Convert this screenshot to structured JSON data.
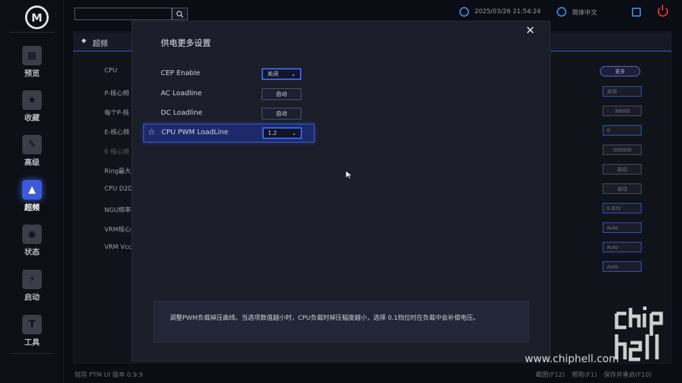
{
  "sidebar": {
    "logo_letter": "M",
    "items": [
      {
        "label": "预览",
        "icon": "grid-icon",
        "active": false
      },
      {
        "label": "收藏",
        "icon": "star-icon",
        "active": false
      },
      {
        "label": "高级",
        "icon": "tools-icon",
        "active": false
      },
      {
        "label": "超频",
        "icon": "rocket-icon",
        "active": true
      },
      {
        "label": "状态",
        "icon": "eye-icon",
        "active": false
      },
      {
        "label": "启动",
        "icon": "boot-icon",
        "active": false
      },
      {
        "label": "工具",
        "icon": "hammer-icon",
        "active": false
      }
    ]
  },
  "topbar": {
    "search_placeholder": "",
    "datetime": "2025/03/26 21:54:24",
    "language": "简体中文"
  },
  "background": {
    "section_title": "超频",
    "more_button": "更多",
    "rows": [
      {
        "label": "CPU",
        "control": ""
      },
      {
        "label": "P-核心频",
        "control": "关闭"
      },
      {
        "label": "每个P-核",
        "control": "30000"
      },
      {
        "label": "E-核心频",
        "control": "0"
      },
      {
        "label": "E-核心频",
        "control": "300000"
      },
      {
        "label": "Ring最大",
        "control": "自动"
      },
      {
        "label": "CPU D2D",
        "control": "自动"
      },
      {
        "label": "NGU频率",
        "control": "0.82V"
      },
      {
        "label": "VRM核心",
        "control": "Auto"
      },
      {
        "label": "VRM Vcc",
        "control": "Auto"
      },
      {
        "label": "",
        "control": "Auto"
      }
    ]
  },
  "modal": {
    "title": "供电更多设置",
    "close_glyph": "✕",
    "rows": [
      {
        "label": "CEP Enable",
        "value": "关闭",
        "type": "select",
        "selected": false
      },
      {
        "label": "AC Loadline",
        "value": "自动",
        "type": "button",
        "selected": false
      },
      {
        "label": "DC Loadline",
        "value": "自动",
        "type": "button",
        "selected": false
      },
      {
        "label": "CPU PWM LoadLine",
        "value": "1.2",
        "type": "select",
        "selected": true
      }
    ],
    "help_text": "调整PWM负载掉压曲线。当选项数值越小时，CPU负载时掉压幅度越小，选择 0.1挡位时在负载中会补偿电压。"
  },
  "footer": {
    "version": "铭瑄 PTM UI 版本 0.9.9",
    "keys": [
      "截图(F12)",
      "帮助(F1)",
      "保存并重启(F10)"
    ]
  },
  "watermark": {
    "site": "www.chiphell.com"
  },
  "colors": {
    "accent": "#3c5bd8",
    "power": "#dd3333",
    "modal_bg": "#1b1e29"
  }
}
